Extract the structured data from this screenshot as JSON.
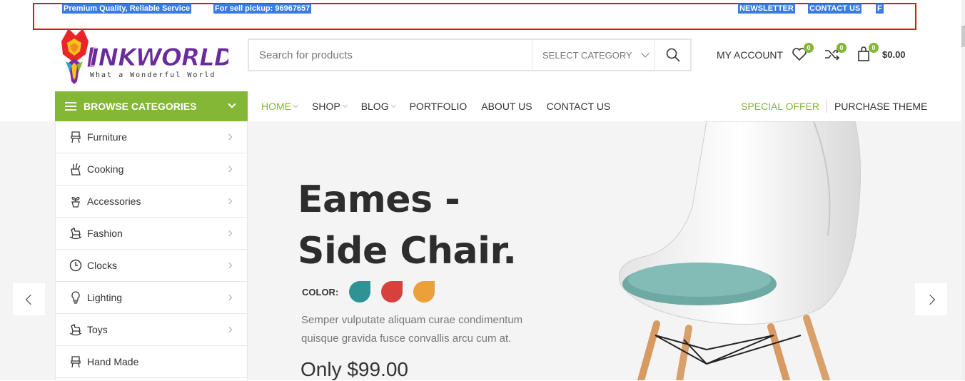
{
  "topbar": {
    "left_text": "Premium Quality, Reliable Service",
    "pickup_text": "For sell pickup: 96967657",
    "newsletter": "NEWSLETTER",
    "contact": "CONTACT US",
    "extra": "F"
  },
  "logo": {
    "brand": "INKWORLD",
    "tagline": "What a Wonderful World"
  },
  "search": {
    "placeholder": "Search for products",
    "category_label": "SELECT CATEGORY"
  },
  "header": {
    "my_account": "MY ACCOUNT",
    "wishlist_count": "0",
    "compare_count": "0",
    "cart_count": "0",
    "cart_total": "$0.00"
  },
  "browse": {
    "label": "BROWSE CATEGORIES"
  },
  "nav": {
    "home": "HOME",
    "shop": "SHOP",
    "blog": "BLOG",
    "portfolio": "PORTFOLIO",
    "about": "ABOUT US",
    "contact": "CONTACT US",
    "special_offer": "SPECIAL OFFER",
    "purchase_theme": "PURCHASE THEME"
  },
  "categories": [
    {
      "label": "Furniture",
      "icon": "chair-icon"
    },
    {
      "label": "Cooking",
      "icon": "knife-block-icon"
    },
    {
      "label": "Accessories",
      "icon": "plant-pot-icon"
    },
    {
      "label": "Fashion",
      "icon": "rocking-horse-icon"
    },
    {
      "label": "Clocks",
      "icon": "clock-icon"
    },
    {
      "label": "Lighting",
      "icon": "lightbulb-icon"
    },
    {
      "label": "Toys",
      "icon": "rocking-horse-icon"
    },
    {
      "label": "Hand Made",
      "icon": "chair-icon"
    }
  ],
  "hero": {
    "title_line1": "Eames -",
    "title_line2": "Side Chair.",
    "color_label": "COLOR:",
    "colors": [
      "#2f9396",
      "#d6413d",
      "#eba03b"
    ],
    "description": "Semper vulputate aliquam curae condimentum quisque gravida fusce convallis arcu cum at.",
    "price": "Only $99.00"
  },
  "accent_color": "#83b735"
}
